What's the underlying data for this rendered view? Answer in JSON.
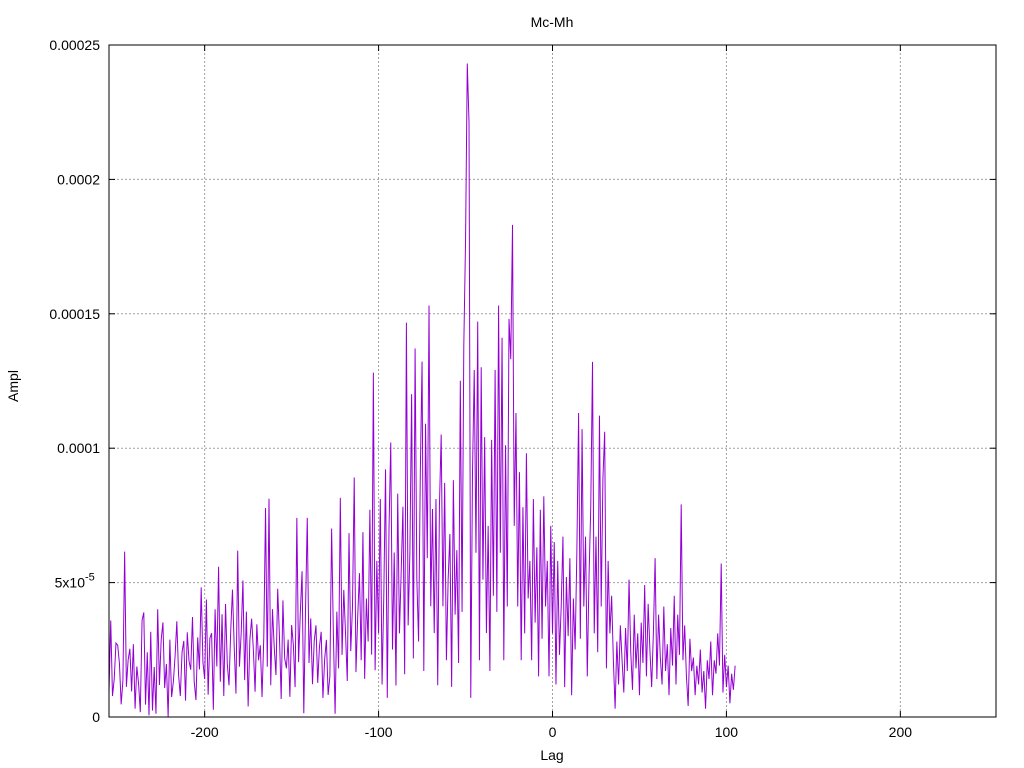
{
  "chart_data": {
    "type": "line",
    "title": "Mc-Mh",
    "xlabel": "Lag",
    "ylabel": "Ampl",
    "xlim": [
      -255,
      255
    ],
    "ylim": [
      0,
      0.00025
    ],
    "x_ticks": [
      {
        "value": -200,
        "label": "-200"
      },
      {
        "value": -100,
        "label": "-100"
      },
      {
        "value": 0,
        "label": "0"
      },
      {
        "value": 100,
        "label": "100"
      },
      {
        "value": 200,
        "label": "200"
      }
    ],
    "y_ticks": [
      {
        "value": 0,
        "label": "0",
        "exp": ""
      },
      {
        "value": 5e-05,
        "label": "5x10",
        "exp": "-5"
      },
      {
        "value": 0.0001,
        "label": "0.0001",
        "exp": ""
      },
      {
        "value": 0.00015,
        "label": "0.00015",
        "exp": ""
      },
      {
        "value": 0.0002,
        "label": "0.0002",
        "exp": ""
      },
      {
        "value": 0.00025,
        "label": "0.00025",
        "exp": ""
      }
    ],
    "grid": true,
    "series": [
      {
        "color": "#9400d3",
        "x_start": -255,
        "x_step": 1,
        "values": [
          9.4e-06,
          3.59e-05,
          7.8e-06,
          1.41e-05,
          2.75e-05,
          2.67e-05,
          1.99e-05,
          4.7e-06,
          1.36e-05,
          6.15e-05,
          1.12e-05,
          2.12e-05,
          2.54e-05,
          9.5e-06,
          2.71e-05,
          3.1e-06,
          1.88e-05,
          1.24e-05,
          1.8e-06,
          3.59e-05,
          3.89e-05,
          4.6e-06,
          2.41e-05,
          6e-07,
          3.17e-05,
          2.4e-06,
          1.86e-05,
          1.2e-06,
          4.01e-05,
          1.19e-05,
          2.87e-05,
          3.52e-05,
          1.08e-05,
          1.97e-05,
          2e-07,
          2.88e-05,
          7.4e-06,
          1.31e-05,
          2.27e-05,
          3.56e-05,
          1.57e-05,
          7.8e-06,
          2.41e-05,
          2.83e-05,
          6.1e-06,
          3.15e-05,
          2.09e-05,
          1.76e-05,
          3.72e-05,
          1.31e-05,
          6.3e-06,
          2.96e-05,
          1.77e-05,
          4.82e-05,
          2.04e-05,
          1.41e-05,
          4.37e-05,
          8.3e-06,
          2.93e-05,
          3.12e-05,
          2.7e-06,
          4.01e-05,
          1.88e-05,
          5.59e-05,
          1.31e-05,
          3.82e-05,
          7.8e-06,
          4.21e-05,
          1.99e-05,
          1.18e-05,
          3.23e-05,
          4.74e-05,
          2.59e-05,
          8.7e-06,
          6.19e-05,
          1.87e-05,
          3.11e-05,
          5.08e-05,
          1.37e-05,
          3.92e-05,
          3.9e-06,
          2.88e-05,
          3.66e-05,
          2.51e-05,
          9.4e-06,
          3.45e-05,
          2.11e-05,
          2.67e-05,
          7.4e-06,
          2.97e-05,
          7.77e-05,
          1.87e-05,
          8.12e-05,
          1.18e-05,
          4.01e-05,
          2.59e-05,
          1.56e-05,
          4.77e-05,
          3.01e-05,
          6.7e-06,
          4.34e-05,
          2.19e-05,
          1.81e-05,
          2.88e-05,
          7.5e-06,
          3.42e-05,
          2.68e-05,
          1.11e-05,
          7.41e-05,
          2.04e-05,
          3.88e-05,
          5.42e-05,
          1.4e-06,
          4.02e-05,
          7.41e-05,
          2.01e-05,
          3.67e-05,
          1.22e-05,
          2.83e-05,
          3.41e-05,
          1.27e-05,
          2.61e-05,
          3.17e-05,
          7.1e-06,
          2.15e-05,
          2.87e-05,
          8.2e-06,
          1.52e-05,
          7.01e-05,
          3.11e-05,
          1.2e-06,
          3.92e-05,
          1.81e-05,
          8.15e-05,
          2.31e-05,
          4.73e-05,
          3.11e-05,
          1.34e-05,
          6.84e-05,
          2.45e-05,
          4.11e-05,
          8.91e-05,
          1.67e-05,
          3.74e-05,
          5.35e-05,
          2.11e-05,
          6.88e-05,
          1.42e-05,
          4.41e-05,
          2.81e-05,
          7.71e-05,
          2.32e-05,
          0.0001281,
          1.74e-05,
          5.81e-05,
          3.12e-05,
          8.11e-05,
          1.21e-05,
          4.52e-05,
          9.21e-05,
          7.1e-06,
          7.01e-05,
          0.0001021,
          2.51e-05,
          6.12e-05,
          1.17e-05,
          8.31e-05,
          3.11e-05,
          5.41e-05,
          7.82e-05,
          1.59e-05,
          0.0001467,
          3.41e-05,
          6.11e-05,
          0.0001201,
          2.18e-05,
          0.0001371,
          5.12e-05,
          2.81e-05,
          9.12e-05,
          0.0001322,
          1.71e-05,
          0.0001091,
          5.91e-05,
          0.0001531,
          4.12e-05,
          7.74e-05,
          3.12e-05,
          8.11e-05,
          1.18e-05,
          7.88e-05,
          0.0001051,
          4.12e-05,
          8.71e-05,
          2.11e-05,
          5.12e-05,
          6.81e-05,
          1.12e-05,
          8.81e-05,
          3.81e-05,
          6.21e-05,
          2.01e-05,
          0.0001251,
          3.91e-05,
          0.0001381,
          0.0001771,
          0.0002431,
          0.0002211,
          7.1e-06,
          9.11e-05,
          0.0001291,
          6.11e-05,
          0.0001471,
          2.11e-05,
          0.0001301,
          5.11e-05,
          0.0001041,
          3.12e-05,
          7.11e-05,
          1.71e-05,
          0.0001031,
          4.51e-05,
          0.0001291,
          3.91e-05,
          0.0001531,
          6.11e-05,
          0.0001411,
          2.11e-05,
          0.0001011,
          4.11e-05,
          0.0001481,
          0.0001331,
          0.0001831,
          7.11e-05,
          0.0001131,
          4.11e-05,
          9.11e-05,
          2.11e-05,
          7.81e-05,
          3.11e-05,
          9.81e-05,
          4.41e-05,
          5.81e-05,
          2.11e-05,
          8.11e-05,
          3.51e-05,
          6.31e-05,
          1.51e-05,
          7.71e-05,
          2.91e-05,
          8.21e-05,
          4.11e-05,
          5.81e-05,
          1.51e-05,
          7.11e-05,
          3.11e-05,
          6.51e-05,
          1.21e-05,
          5.81e-05,
          2.31e-05,
          4.11e-05,
          6.71e-05,
          1.11e-05,
          5.21e-05,
          3.01e-05,
          5.91e-05,
          8.1e-06,
          4.41e-05,
          2.51e-05,
          6.11e-05,
          0.0001131,
          2.91e-05,
          0.0001071,
          4.11e-05,
          6.71e-05,
          1.51e-05,
          5.21e-05,
          7.81e-05,
          0.0001321,
          3.11e-05,
          6.71e-05,
          2.41e-05,
          0.0001121,
          4.11e-05,
          8.91e-05,
          0.0001061,
          1.81e-05,
          5.81e-05,
          3.11e-05,
          4.51e-05,
          2.11e-05,
          3.1e-06,
          2.81e-05,
          1.21e-05,
          3.41e-05,
          2.11e-05,
          9.1e-06,
          3.31e-05,
          1.71e-05,
          5.11e-05,
          2.41e-05,
          1.01e-05,
          3.81e-05,
          1.81e-05,
          3.11e-05,
          8.1e-06,
          3.51e-05,
          2.01e-05,
          4.91e-05,
          1.51e-05,
          4.21e-05,
          2.51e-05,
          1.11e-05,
          3.11e-05,
          5.91e-05,
          1.41e-05,
          3.81e-05,
          2.21e-05,
          1.21e-05,
          4.11e-05,
          1.71e-05,
          2.71e-05,
          8.1e-06,
          3.31e-05,
          1.91e-05,
          4.51e-05,
          1.21e-05,
          3.81e-05,
          2.31e-05,
          7.91e-05,
          2.11e-05,
          3.41e-05,
          1.51e-05,
          4.1e-06,
          2.91e-05,
          1.71e-05,
          2.21e-05,
          8.1e-06,
          1.91e-05,
          1.21e-05,
          2.51e-05,
          9.1e-06,
          1.71e-05,
          3.1e-06,
          2.11e-05,
          1.41e-05,
          2.81e-05,
          8.1e-06,
          2.11e-05,
          1.61e-05,
          3.11e-05,
          1.91e-05,
          5.71e-05,
          9.1e-06,
          2.31e-05,
          1.11e-05,
          1.91e-05,
          5.1e-06,
          1.61e-05,
          1.01e-05,
          1.91e-05
        ]
      }
    ]
  }
}
